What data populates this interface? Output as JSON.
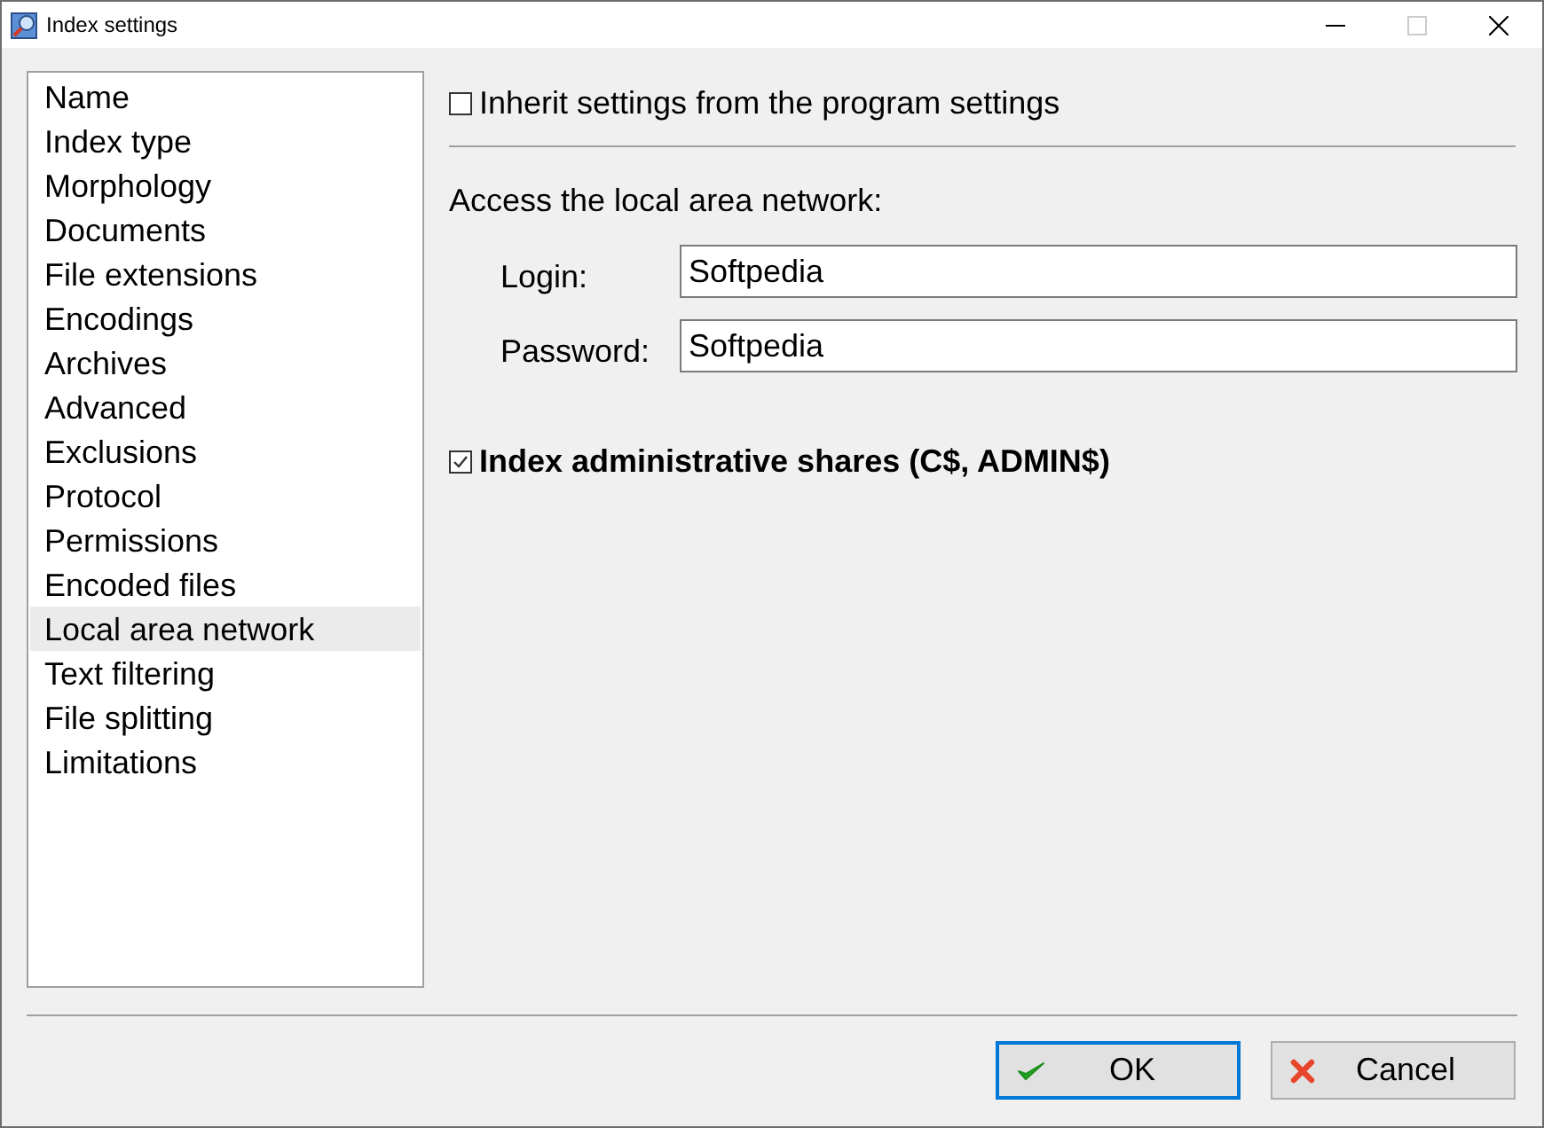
{
  "window": {
    "title": "Index settings",
    "controls": [
      {
        "kind": "minimize",
        "disabled": false
      },
      {
        "kind": "maximize",
        "disabled": true
      },
      {
        "kind": "close",
        "disabled": false
      }
    ]
  },
  "sidebar": {
    "items": [
      {
        "label": "Name",
        "selected": false
      },
      {
        "label": "Index type",
        "selected": false
      },
      {
        "label": "Morphology",
        "selected": false
      },
      {
        "label": "Documents",
        "selected": false
      },
      {
        "label": "File extensions",
        "selected": false
      },
      {
        "label": "Encodings",
        "selected": false
      },
      {
        "label": "Archives",
        "selected": false
      },
      {
        "label": "Advanced",
        "selected": false
      },
      {
        "label": "Exclusions",
        "selected": false
      },
      {
        "label": "Protocol",
        "selected": false
      },
      {
        "label": "Permissions",
        "selected": false
      },
      {
        "label": "Encoded files",
        "selected": false
      },
      {
        "label": "Local area network",
        "selected": true
      },
      {
        "label": "Text filtering",
        "selected": false
      },
      {
        "label": "File splitting",
        "selected": false
      },
      {
        "label": "Limitations",
        "selected": false
      }
    ]
  },
  "inherit_checkbox": {
    "label": "Inherit settings from the program settings",
    "checked": false
  },
  "section_label": "Access the local area network:",
  "fields": [
    {
      "label": "Login:",
      "value": "Softpedia"
    },
    {
      "label": "Password:",
      "value": "Softpedia"
    }
  ],
  "admin_shares_checkbox": {
    "label": "Index administrative shares (C$, ADMIN$)",
    "checked": true
  },
  "buttons": [
    {
      "label": "OK",
      "kind": "ok",
      "focused": true
    },
    {
      "label": "Cancel",
      "kind": "cancel",
      "focused": false
    }
  ]
}
